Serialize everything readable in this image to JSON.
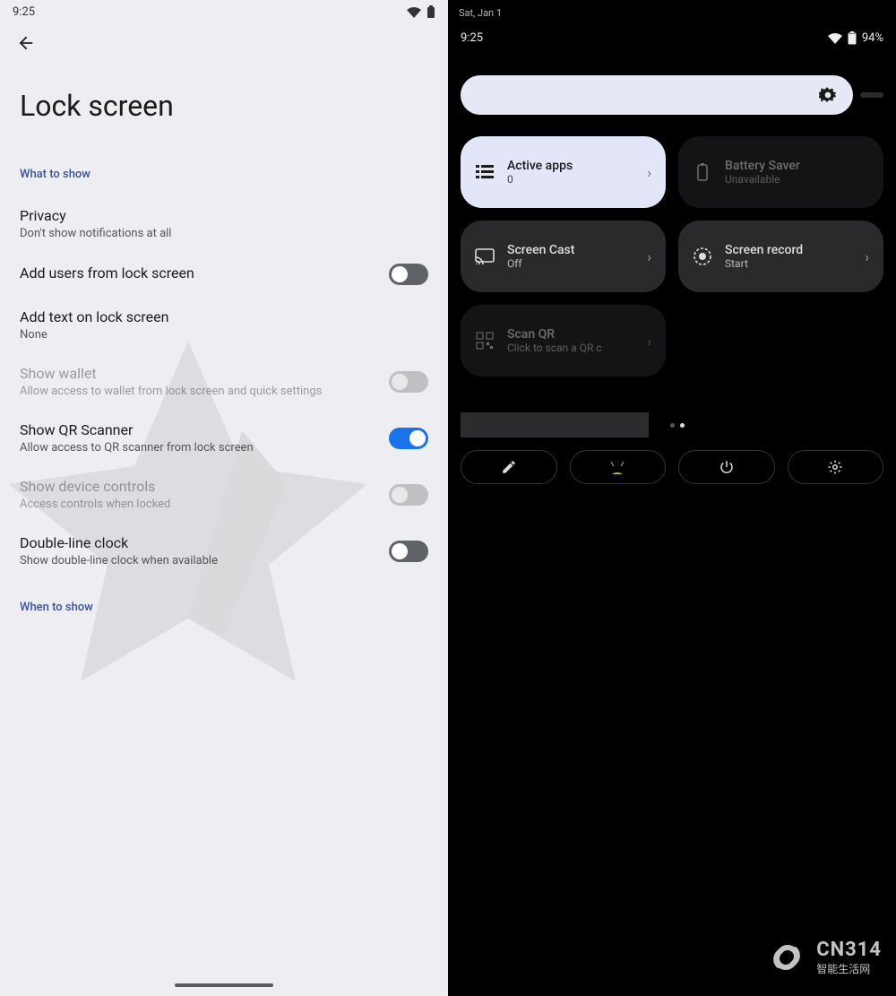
{
  "left": {
    "status": {
      "time": "9:25"
    },
    "title": "Lock screen",
    "section_what": "What to show",
    "section_when": "When to show",
    "items": [
      {
        "title": "Privacy",
        "sub": "Don't show notifications at all",
        "toggle": null
      },
      {
        "title": "Add users from lock screen",
        "sub": "",
        "toggle": "off"
      },
      {
        "title": "Add text on lock screen",
        "sub": "None",
        "toggle": null
      },
      {
        "title": "Show wallet",
        "sub": "Allow access to wallet from lock screen and quick settings",
        "toggle": "off-dim",
        "dim": true
      },
      {
        "title": "Show QR Scanner",
        "sub": "Allow access to QR scanner from lock screen",
        "toggle": "on"
      },
      {
        "title": "Show device controls",
        "sub": "Access controls when locked",
        "toggle": "off-dim",
        "dim": true
      },
      {
        "title": "Double-line clock",
        "sub": "Show double-line clock when available",
        "toggle": "off"
      }
    ]
  },
  "right": {
    "date": "Sat, Jan 1",
    "status": {
      "time": "9:25",
      "battery": "94%"
    },
    "tiles": [
      {
        "icon": "list",
        "title": "Active apps",
        "sub": "0",
        "style": "light",
        "chev": true
      },
      {
        "icon": "battery",
        "title": "Battery Saver",
        "sub": "Unavailable",
        "style": "dim",
        "chev": false
      },
      {
        "icon": "cast",
        "title": "Screen Cast",
        "sub": "Off",
        "style": "normal",
        "chev": true
      },
      {
        "icon": "record",
        "title": "Screen record",
        "sub": "Start",
        "style": "normal",
        "chev": true
      },
      {
        "icon": "qr",
        "title": "Scan QR",
        "sub": "Click to scan a QR c",
        "style": "dim",
        "chev": true
      }
    ],
    "logo": {
      "brand": "CN314",
      "tagline": "智能生活网"
    }
  }
}
